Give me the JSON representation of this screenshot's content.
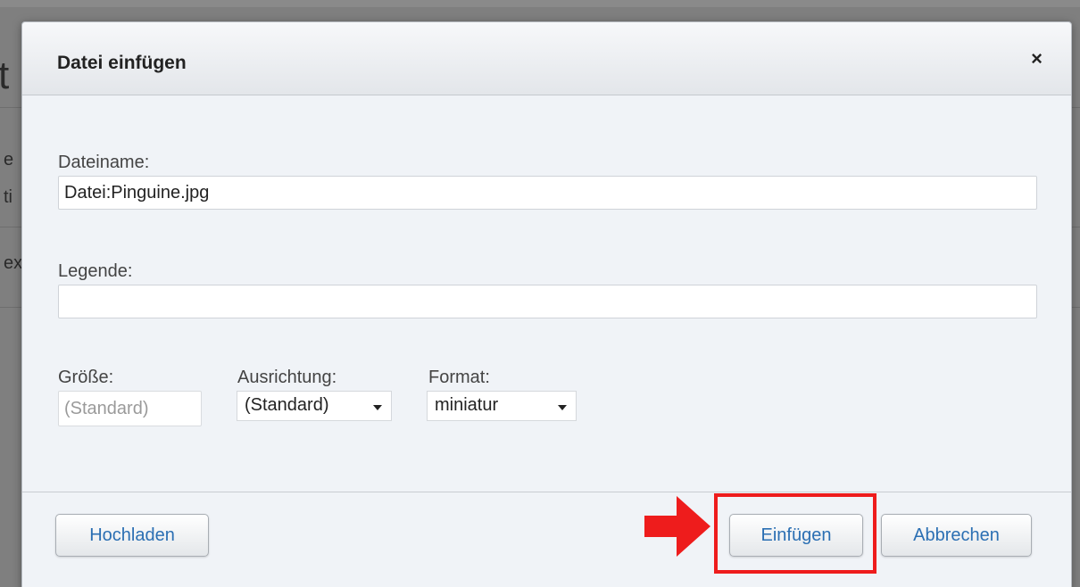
{
  "background": {
    "fragments": [
      "t",
      "e",
      "ti",
      "ex"
    ]
  },
  "dialog": {
    "title": "Datei einfügen",
    "close_glyph": "×",
    "filename": {
      "label": "Dateiname:",
      "value": "Datei:Pinguine.jpg"
    },
    "caption": {
      "label": "Legende:",
      "value": ""
    },
    "size": {
      "label": "Größe:",
      "placeholder": "(Standard)"
    },
    "alignment": {
      "label": "Ausrichtung:",
      "selected": "(Standard)"
    },
    "format": {
      "label": "Format:",
      "selected": "miniatur"
    },
    "buttons": {
      "upload": "Hochladen",
      "insert": "Einfügen",
      "cancel": "Abbrechen"
    }
  },
  "annotation": {
    "color": "#ee1c1c"
  },
  "colors": {
    "link_text": "#2b6fb3",
    "dialog_bg": "#f0f3f7"
  }
}
